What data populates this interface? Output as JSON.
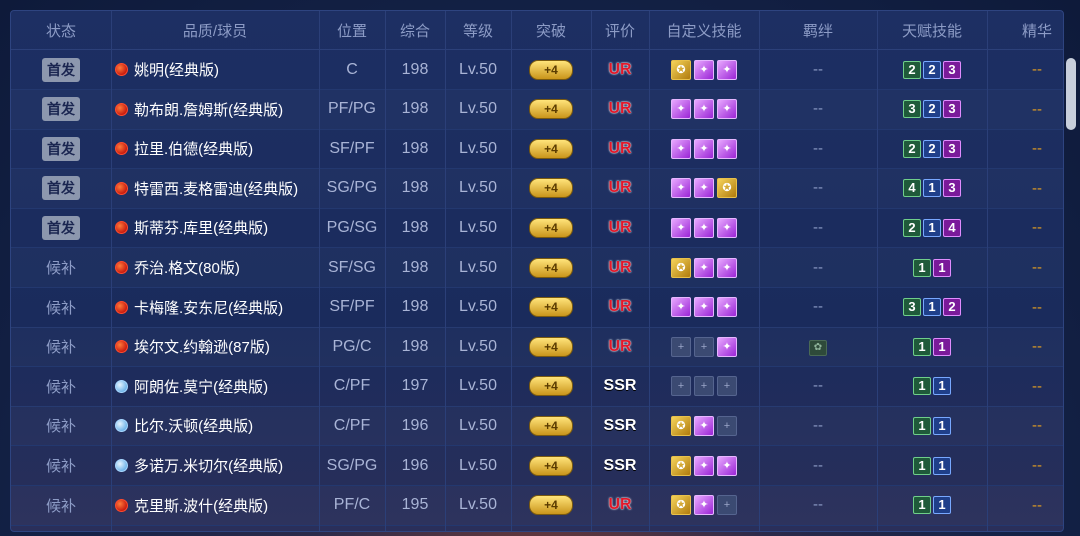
{
  "header": {
    "status": "状态",
    "name": "品质/球员",
    "position": "位置",
    "overall": "综合",
    "level": "等级",
    "breakthrough": "突破",
    "rating": "评价",
    "custom_skill": "自定义技能",
    "bond": "羁绊",
    "talent": "天赋技能",
    "essence": "精华"
  },
  "colors": {
    "ur": "#e0192b",
    "starter_badge": "#8c97ae",
    "essence": "#e6a020"
  },
  "players": [
    {
      "status": "首发",
      "starter": true,
      "ball": "red",
      "name": "姚明(经典版)",
      "pos": "C",
      "ovr": "198",
      "lvl": "Lv.50",
      "brk": "+4",
      "rate": "UR",
      "skills": [
        "gold",
        "purple",
        "purple"
      ],
      "bond": "--",
      "talents": [
        [
          "2",
          "g"
        ],
        [
          "2",
          "b"
        ],
        [
          "3",
          "p"
        ]
      ],
      "ess": "--"
    },
    {
      "status": "首发",
      "starter": true,
      "ball": "red",
      "name": "勒布朗.詹姆斯(经典版)",
      "pos": "PF/PG",
      "ovr": "198",
      "lvl": "Lv.50",
      "brk": "+4",
      "rate": "UR",
      "skills": [
        "purple",
        "purple",
        "purple"
      ],
      "bond": "--",
      "talents": [
        [
          "3",
          "g"
        ],
        [
          "2",
          "b"
        ],
        [
          "3",
          "p"
        ]
      ],
      "ess": "--"
    },
    {
      "status": "首发",
      "starter": true,
      "ball": "red",
      "name": "拉里.伯德(经典版)",
      "pos": "SF/PF",
      "ovr": "198",
      "lvl": "Lv.50",
      "brk": "+4",
      "rate": "UR",
      "skills": [
        "purple",
        "purple",
        "purple"
      ],
      "bond": "--",
      "talents": [
        [
          "2",
          "g"
        ],
        [
          "2",
          "b"
        ],
        [
          "3",
          "p"
        ]
      ],
      "ess": "--"
    },
    {
      "status": "首发",
      "starter": true,
      "ball": "red",
      "name": "特雷西.麦格雷迪(经典版)",
      "pos": "SG/PG",
      "ovr": "198",
      "lvl": "Lv.50",
      "brk": "+4",
      "rate": "UR",
      "skills": [
        "purple",
        "purple",
        "gold"
      ],
      "bond": "--",
      "talents": [
        [
          "4",
          "g"
        ],
        [
          "1",
          "b"
        ],
        [
          "3",
          "p"
        ]
      ],
      "ess": "--"
    },
    {
      "status": "首发",
      "starter": true,
      "ball": "red",
      "name": "斯蒂芬.库里(经典版)",
      "pos": "PG/SG",
      "ovr": "198",
      "lvl": "Lv.50",
      "brk": "+4",
      "rate": "UR",
      "skills": [
        "purple",
        "purple",
        "purple"
      ],
      "bond": "--",
      "talents": [
        [
          "2",
          "g"
        ],
        [
          "1",
          "b"
        ],
        [
          "4",
          "p"
        ]
      ],
      "ess": "--"
    },
    {
      "status": "候补",
      "starter": false,
      "ball": "red",
      "name": "乔治.格文(80版)",
      "pos": "SF/SG",
      "ovr": "198",
      "lvl": "Lv.50",
      "brk": "+4",
      "rate": "UR",
      "skills": [
        "gold",
        "purple",
        "purple"
      ],
      "bond": "--",
      "talents": [
        [
          "1",
          "g"
        ],
        [
          "1",
          "p"
        ]
      ],
      "ess": "--"
    },
    {
      "status": "候补",
      "starter": false,
      "ball": "red",
      "name": "卡梅隆.安东尼(经典版)",
      "pos": "SF/PF",
      "ovr": "198",
      "lvl": "Lv.50",
      "brk": "+4",
      "rate": "UR",
      "skills": [
        "purple",
        "purple",
        "purple"
      ],
      "bond": "--",
      "talents": [
        [
          "3",
          "g"
        ],
        [
          "1",
          "b"
        ],
        [
          "2",
          "p"
        ]
      ],
      "ess": "--"
    },
    {
      "status": "候补",
      "starter": false,
      "ball": "red",
      "name": "埃尔文.约翰逊(87版)",
      "pos": "PG/C",
      "ovr": "198",
      "lvl": "Lv.50",
      "brk": "+4",
      "rate": "UR",
      "skills": [
        "empty",
        "empty",
        "purple"
      ],
      "bond": "icon",
      "talents": [
        [
          "1",
          "g"
        ],
        [
          "1",
          "p"
        ]
      ],
      "ess": "--"
    },
    {
      "status": "候补",
      "starter": false,
      "ball": "blue",
      "name": "阿朗佐.莫宁(经典版)",
      "pos": "C/PF",
      "ovr": "197",
      "lvl": "Lv.50",
      "brk": "+4",
      "rate": "SSR",
      "skills": [
        "empty",
        "empty",
        "empty"
      ],
      "bond": "--",
      "talents": [
        [
          "1",
          "g"
        ],
        [
          "1",
          "b"
        ]
      ],
      "ess": "--"
    },
    {
      "status": "候补",
      "starter": false,
      "ball": "blue",
      "name": "比尔.沃顿(经典版)",
      "pos": "C/PF",
      "ovr": "196",
      "lvl": "Lv.50",
      "brk": "+4",
      "rate": "SSR",
      "skills": [
        "gold",
        "purple",
        "empty"
      ],
      "bond": "--",
      "talents": [
        [
          "1",
          "g"
        ],
        [
          "1",
          "b"
        ]
      ],
      "ess": "--"
    },
    {
      "status": "候补",
      "starter": false,
      "ball": "blue",
      "name": "多诺万.米切尔(经典版)",
      "pos": "SG/PG",
      "ovr": "196",
      "lvl": "Lv.50",
      "brk": "+4",
      "rate": "SSR",
      "skills": [
        "gold",
        "purple",
        "purple"
      ],
      "bond": "--",
      "talents": [
        [
          "1",
          "g"
        ],
        [
          "1",
          "b"
        ]
      ],
      "ess": "--"
    },
    {
      "status": "候补",
      "starter": false,
      "ball": "red",
      "name": "克里斯.波什(经典版)",
      "pos": "PF/C",
      "ovr": "195",
      "lvl": "Lv.50",
      "brk": "+4",
      "rate": "UR",
      "skills": [
        "gold",
        "purple",
        "empty"
      ],
      "bond": "--",
      "talents": [
        [
          "1",
          "g"
        ],
        [
          "1",
          "b"
        ]
      ],
      "ess": "--"
    }
  ]
}
